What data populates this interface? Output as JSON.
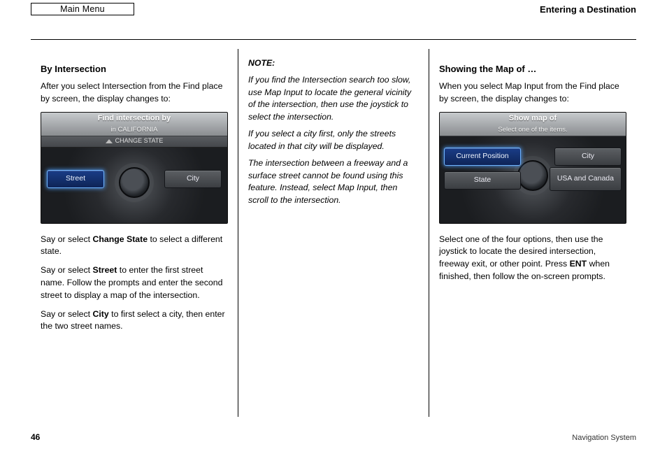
{
  "top": {
    "main_menu": "Main Menu",
    "title": "Entering a Destination"
  },
  "col1": {
    "heading": "By Intersection",
    "intro": "After you select Intersection from the Find place by screen, the display changes to:",
    "device": {
      "title1": "Find intersection by",
      "title2": "in CALIFORNIA",
      "change": "CHANGE STATE",
      "btn_left": "Street",
      "btn_right": "City"
    },
    "p1_a": "Say or select ",
    "p1_b": "Change State",
    "p1_c": " to select a different state.",
    "p2_a": "Say or select ",
    "p2_b": "Street",
    "p2_c": " to enter the first street name. Follow the prompts and enter the second street to display a map of the intersection.",
    "p3_a": "Say or select ",
    "p3_b": "City",
    "p3_c": " to first select a city, then enter the two street names."
  },
  "col2": {
    "note_label": "NOTE:",
    "n1": "If you find the Intersection search too slow, use Map Input to locate the general vicinity of the intersection, then use the joystick to select the intersection.",
    "n2": "If you select a city first, only the streets located in that city will be displayed.",
    "n3": "The intersection between a freeway and a surface street cannot be found using this feature. Instead, select Map Input, then scroll to the intersection."
  },
  "col3": {
    "heading": "Showing the Map of …",
    "intro": "When you select Map Input from the Find place by screen, the display changes to:",
    "device": {
      "title1": "Show map of",
      "subtitle": "Select one of the items.",
      "btn_tl": "Current Position",
      "btn_tr": "City",
      "btn_bl": "State",
      "btn_br": "USA and Canada"
    },
    "p1_a": "Select one of the four options, then use the joystick to locate the desired intersection, freeway exit, or other point. Press ",
    "p1_b": "ENT",
    "p1_c": " when finished, then follow the on-screen prompts."
  },
  "page_number": "46",
  "footer": "Navigation System"
}
